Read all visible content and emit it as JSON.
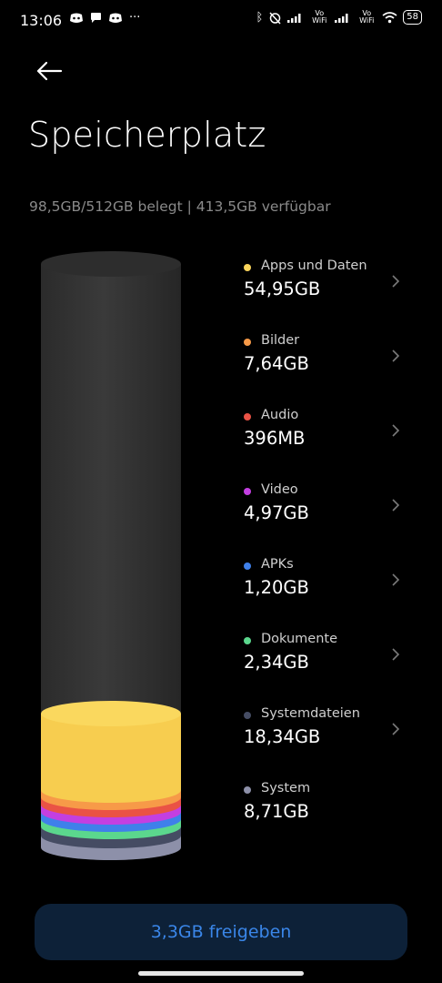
{
  "status_bar": {
    "time": "13:06",
    "left_icons": [
      "discord-icon",
      "chat-bubble-icon",
      "discord-icon",
      "more-dots-icon"
    ],
    "right_icons": [
      "bluetooth-icon",
      "alarm-off-icon",
      "signal-icon",
      "vowifi-icon",
      "signal-icon",
      "vowifi-icon",
      "wifi-icon",
      "battery-icon"
    ],
    "vowifi_label": "Vo WiFi",
    "battery": "58"
  },
  "header": {
    "title": "Speicherplatz",
    "subtitle": "98,5GB/512GB belegt | 413,5GB verfügbar"
  },
  "categories": [
    {
      "name": "Apps und Daten",
      "size": "54,95GB",
      "color": "#fad45b",
      "chevron": true
    },
    {
      "name": "Bilder",
      "size": "7,64GB",
      "color": "#f79a48",
      "chevron": true
    },
    {
      "name": "Audio",
      "size": "396MB",
      "color": "#ea5245",
      "chevron": true
    },
    {
      "name": "Video",
      "size": "4,97GB",
      "color": "#c33fe1",
      "chevron": true
    },
    {
      "name": "APKs",
      "size": "1,20GB",
      "color": "#3f80ea",
      "chevron": true
    },
    {
      "name": "Dokumente",
      "size": "2,34GB",
      "color": "#5bd78d",
      "chevron": true
    },
    {
      "name": "Systemdateien",
      "size": "18,34GB",
      "color": "#454c63",
      "chevron": true
    },
    {
      "name": "System",
      "size": "8,71GB",
      "color": "#8d90a9",
      "chevron": false
    }
  ],
  "free_button": {
    "label": "3,3GB freigeben"
  }
}
